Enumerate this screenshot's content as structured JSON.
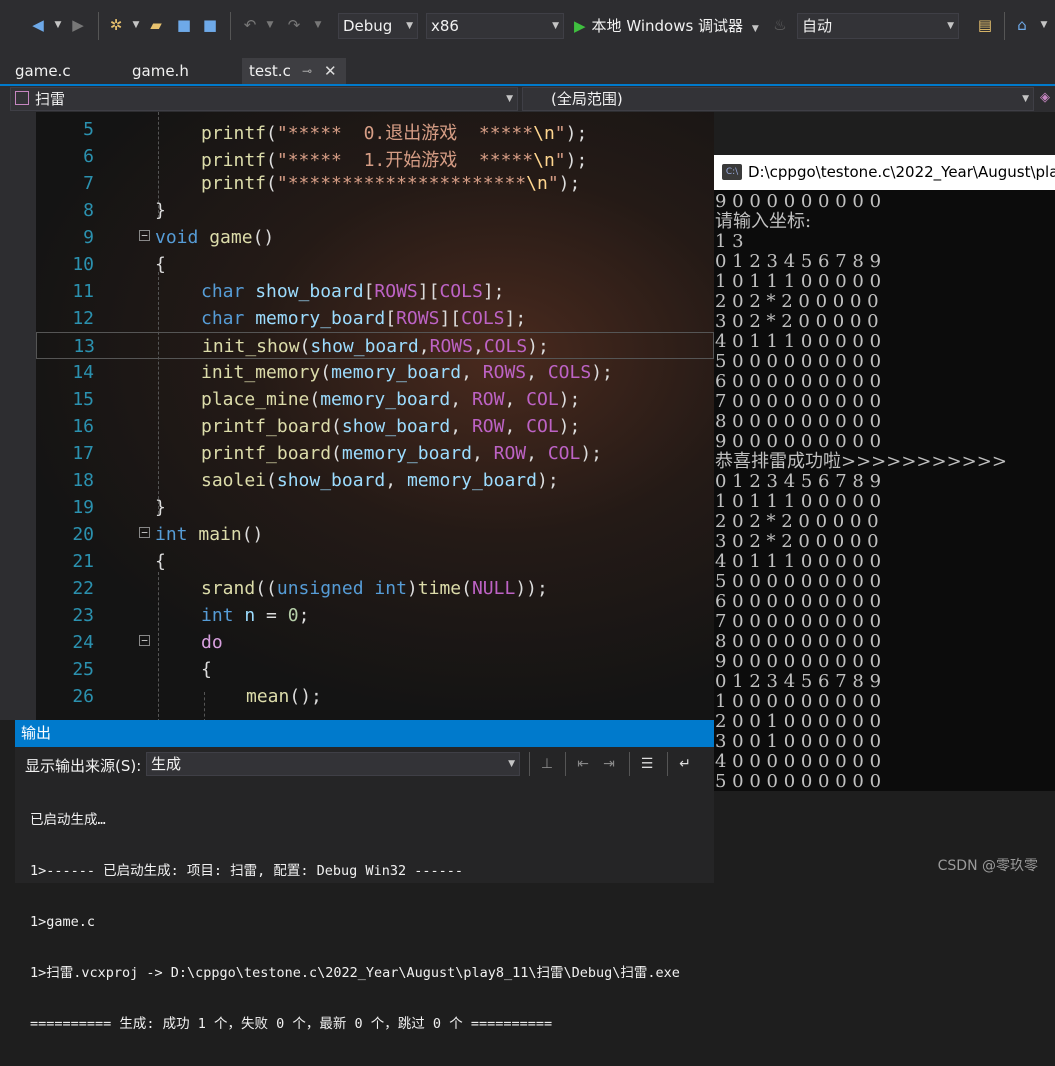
{
  "toolbar": {
    "config": "Debug",
    "platform": "x86",
    "run_label": "本地 Windows 调试器",
    "auto": "自动"
  },
  "tabs": [
    {
      "label": "game.c"
    },
    {
      "label": "game.h"
    },
    {
      "label": "test.c"
    }
  ],
  "nav": {
    "project": "扫雷",
    "scope": "(全局范围)"
  },
  "editor": {
    "line_numbers": [
      "5",
      "6",
      "7",
      "8",
      "9",
      "10",
      "11",
      "12",
      "13",
      "14",
      "15",
      "16",
      "17",
      "18",
      "19",
      "20",
      "21",
      "22",
      "23",
      "24",
      "25",
      "26"
    ]
  },
  "console": {
    "title": "D:\\cppgo\\testone.c\\2022_Year\\August\\pla",
    "lines": [
      "9 0 0 0 0 0 0 0 0 0",
      "请输入坐标:",
      "1 3",
      "0 1 2 3 4 5 6 7 8 9",
      "1 0 1 1 1 0 0 0 0 0",
      "2 0 2 * 2 0 0 0 0 0",
      "3 0 2 * 2 0 0 0 0 0",
      "4 0 1 1 1 0 0 0 0 0",
      "5 0 0 0 0 0 0 0 0 0",
      "6 0 0 0 0 0 0 0 0 0",
      "7 0 0 0 0 0 0 0 0 0",
      "8 0 0 0 0 0 0 0 0 0",
      "9 0 0 0 0 0 0 0 0 0",
      "恭喜排雷成功啦>>>>>>>>>>>",
      "0 1 2 3 4 5 6 7 8 9",
      "1 0 1 1 1 0 0 0 0 0",
      "2 0 2 * 2 0 0 0 0 0",
      "3 0 2 * 2 0 0 0 0 0",
      "4 0 1 1 1 0 0 0 0 0",
      "5 0 0 0 0 0 0 0 0 0",
      "6 0 0 0 0 0 0 0 0 0",
      "7 0 0 0 0 0 0 0 0 0",
      "8 0 0 0 0 0 0 0 0 0",
      "9 0 0 0 0 0 0 0 0 0",
      "0 1 2 3 4 5 6 7 8 9",
      "1 0 0 0 0 0 0 0 0 0",
      "2 0 0 1 0 0 0 0 0 0",
      "3 0 0 1 0 0 0 0 0 0",
      "4 0 0 0 0 0 0 0 0 0",
      "5 0 0 0 0 0 0 0 0 0"
    ]
  },
  "output": {
    "header": "输出",
    "source_label": "显示输出来源(S):",
    "source_value": "生成",
    "lines": [
      "已启动生成…",
      "1>------ 已启动生成: 项目: 扫雷, 配置: Debug Win32 ------",
      "1>game.c",
      "1>扫雷.vcxproj -> D:\\cppgo\\testone.c\\2022_Year\\August\\play8_11\\扫雷\\Debug\\扫雷.exe",
      "========== 生成: 成功 1 个，失败 0 个，最新 0 个，跳过 0 个 =========="
    ]
  },
  "watermark": "CSDN @零玖零"
}
